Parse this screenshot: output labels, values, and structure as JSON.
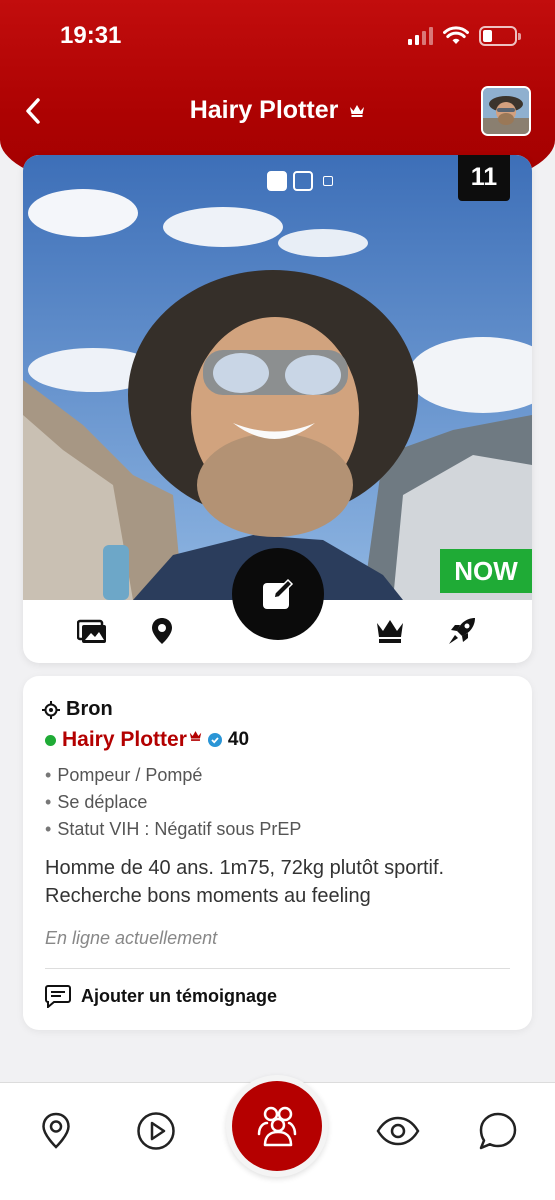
{
  "status_bar": {
    "time": "19:31"
  },
  "header": {
    "title": "Hairy Plotter"
  },
  "photo": {
    "count": "11",
    "now_label": "NOW",
    "photo_index": 1,
    "photo_dots": 3
  },
  "profile": {
    "city": "Bron",
    "name": "Hairy Plotter",
    "age": "40",
    "tags": [
      "Pompeur / Pompé",
      "Se déplace",
      "Statut VIH : Négatif sous PrEP"
    ],
    "description_line1": "Homme de 40 ans. 1m75, 72kg plutôt sportif.",
    "description_line2": "Recherche bons moments au feeling",
    "online_status": "En ligne actuellement",
    "add_testimony": "Ajouter un témoignage"
  },
  "colors": {
    "brand_red": "#b30000",
    "online_green": "#1fab36",
    "verified_blue": "#2a95d6"
  },
  "icons": {
    "actions": [
      "photos-icon",
      "location-pin-icon",
      "edit-icon",
      "crown-icon",
      "rocket-icon"
    ],
    "tabs": [
      "map-pin-icon",
      "play-icon",
      "people-icon",
      "eye-icon",
      "chat-icon"
    ]
  }
}
